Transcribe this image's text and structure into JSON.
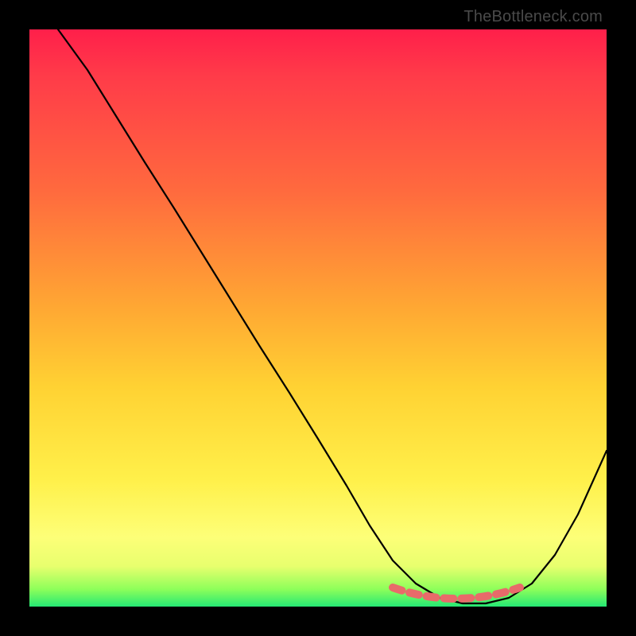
{
  "attribution": "TheBottleneck.com",
  "chart_data": {
    "type": "line",
    "title": "",
    "xlabel": "",
    "ylabel": "",
    "xlim": [
      0,
      100
    ],
    "ylim": [
      0,
      100
    ],
    "background_gradient": {
      "top_color": "#ff1f4a",
      "bottom_color": "#25e874",
      "meaning": "bottleneck-severity (red high, green low)"
    },
    "series": [
      {
        "name": "bottleneck-curve",
        "x": [
          5,
          10,
          15,
          20,
          25,
          30,
          35,
          40,
          45,
          50,
          55,
          59,
          63,
          67,
          71,
          75,
          79,
          83,
          87,
          91,
          95,
          100
        ],
        "y": [
          100,
          93,
          85,
          77,
          69,
          61,
          53,
          45,
          37,
          29,
          21,
          14,
          8,
          4,
          1.5,
          0.5,
          0.5,
          1.5,
          4,
          9,
          16,
          27
        ]
      }
    ],
    "trough_region": {
      "x_start": 63,
      "x_end": 85,
      "y": 0.8
    },
    "colors": {
      "curve": "#000000",
      "trough_marker": "#e86a6a",
      "frame": "#000000"
    }
  }
}
